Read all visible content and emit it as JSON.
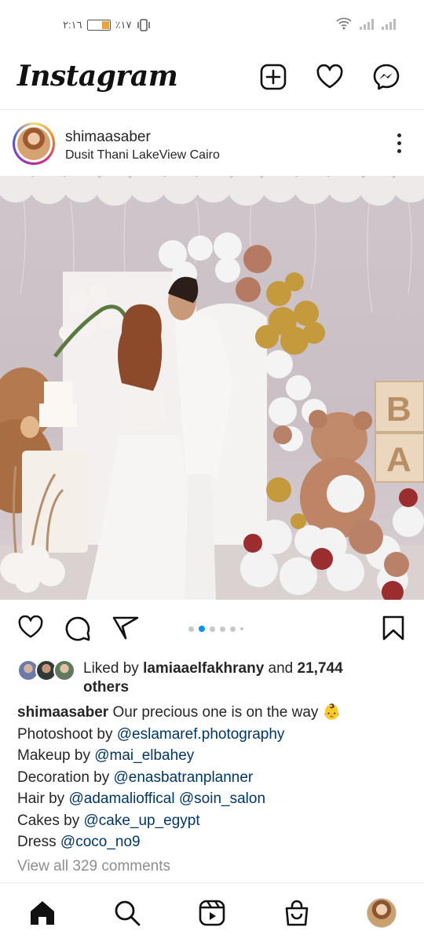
{
  "status_bar": {
    "time": "٢:١٦",
    "battery": "٪١٧"
  },
  "app": {
    "logo": "Instagram",
    "icons": [
      "new-post-icon",
      "heart-icon",
      "messenger-icon"
    ]
  },
  "post": {
    "username": "shimaasaber",
    "location": "Dusit Thani LakeView Cairo",
    "carousel": {
      "count": 6,
      "active_index": 1
    },
    "likes": {
      "liked_by_prefix": "Liked by",
      "liked_by_user": "lamiaaelfakhrany",
      "and": "and",
      "others_count": "21,744",
      "others": "others"
    },
    "caption": {
      "username": "shimaasaber",
      "text": "Our precious one is on the way 👶",
      "credits": [
        {
          "label": "Photoshoot by",
          "handle": "@eslamaref.photography"
        },
        {
          "label": "Makeup by",
          "handle": "@mai_elbahey"
        },
        {
          "label": "Decoration by",
          "handle": "@enasbatranplanner"
        },
        {
          "label": "Hair by",
          "handle": "@adamalioffical",
          "handle2": "@soin_salon"
        },
        {
          "label": "Cakes by",
          "handle": "@cake_up_egypt"
        },
        {
          "label": "Dress",
          "handle": "@coco_no9"
        }
      ]
    },
    "view_comments": "View all 329 comments"
  },
  "bottom_nav": [
    "home-icon",
    "search-icon",
    "reels-icon",
    "shop-icon",
    "profile-avatar"
  ],
  "colors": {
    "link": "#00376b",
    "accent_blue": "#0095f6",
    "muted": "#8e8e8e",
    "text": "#262626"
  }
}
